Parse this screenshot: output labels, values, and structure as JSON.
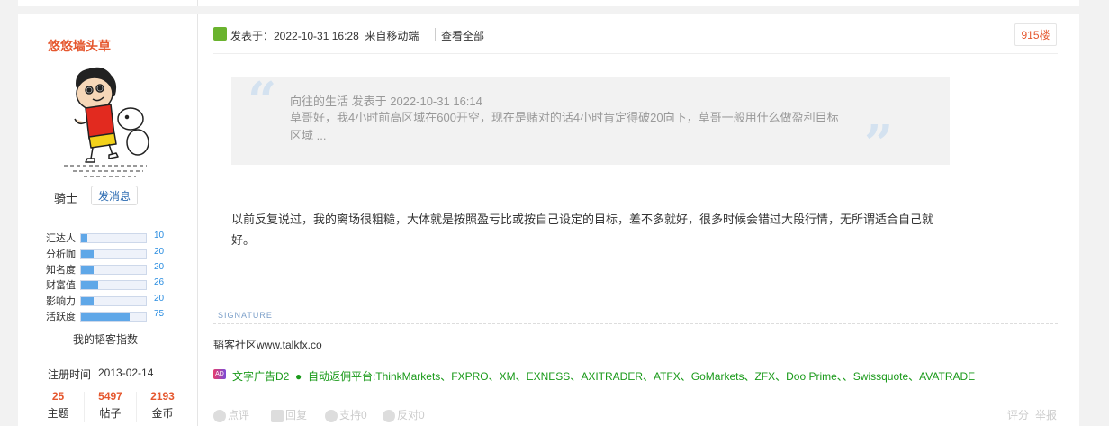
{
  "author": {
    "name": "悠悠墙头草",
    "rank": "骑士",
    "message_button": "发消息",
    "stats": [
      {
        "label": "汇达人",
        "value": "10",
        "level": 0.1
      },
      {
        "label": "分析咖",
        "value": "20",
        "level": 0.2
      },
      {
        "label": "知名度",
        "value": "20",
        "level": 0.2
      },
      {
        "label": "财富值",
        "value": "26",
        "level": 0.26
      },
      {
        "label": "影响力",
        "value": "20",
        "level": 0.2
      },
      {
        "label": "活跃度",
        "value": "75",
        "level": 0.75
      }
    ],
    "index_label": "我的韬客指数",
    "register_label": "注册时间",
    "register_date": "2013-02-14",
    "counts": [
      {
        "num": "25",
        "label": "主题"
      },
      {
        "num": "5497",
        "label": "帖子"
      },
      {
        "num": "2193",
        "label": "金币"
      }
    ]
  },
  "post": {
    "meta": "发表于：2022-10-31 16:28",
    "source": "来自移动端",
    "view_all": "查看全部",
    "floor": "915楼",
    "quote_header": "向往的生活 发表于 2022-10-31 16:14",
    "quote_body": "草哥好，我4小时前高区域在600开空，现在是赌对的话4小时肯定得破20向下，草哥一般用什么做盈利目标区域 ...",
    "content": "以前反复说过，我的离场很粗糙，大体就是按照盈亏比或按自己设定的目标，差不多就好，很多时候会错过大段行情，无所谓适合自己就好。",
    "signature_label": "SIGNATURE",
    "signature_text": "韬客社区www.talkfx.co",
    "ad_badge": "AD",
    "ad_text": "文字广告D2",
    "ad_bullet": "●",
    "ad_link": "自动返佣平台:ThinkMarkets、FXPRO、XM、EXNESS、AXITRADER、ATFX、GoMarkets、ZFX、Doo Prime、、Swissquote、AVATRADE"
  },
  "actions": {
    "rate": "点评",
    "reply": "回复",
    "support": "支持0",
    "oppose": "反对0",
    "score": "评分",
    "report": "举报"
  },
  "colors": {
    "author": "#e5572e",
    "link_green": "#1a9a1a",
    "bar_fill": "#5fa7e8"
  }
}
